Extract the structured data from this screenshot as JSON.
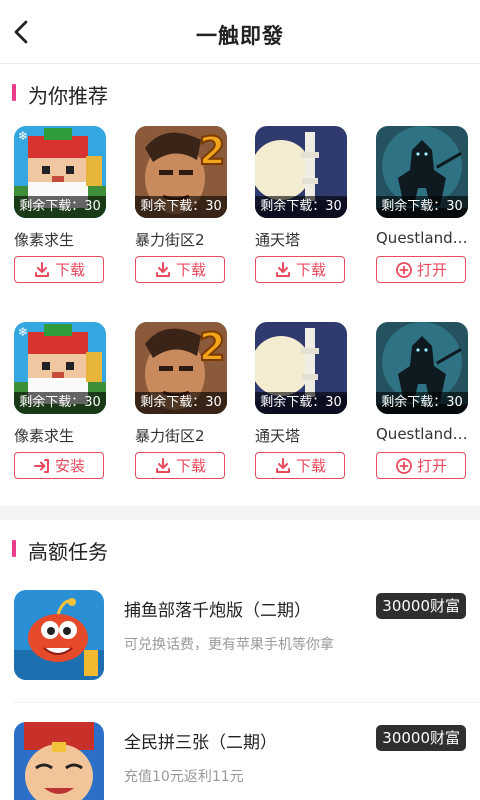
{
  "header": {
    "title": "一触即發"
  },
  "recommend": {
    "title": "为你推荐",
    "rows": [
      [
        {
          "name": "像素求生",
          "tag": "剩余下载：30",
          "button": "下载",
          "button_icon": "download-icon",
          "art": "pixel"
        },
        {
          "name": "暴力街区2",
          "tag": "剩余下载：30",
          "button": "下载",
          "button_icon": "download-icon",
          "art": "fighter"
        },
        {
          "name": "通天塔",
          "tag": "剩余下载：30",
          "button": "下载",
          "button_icon": "download-icon",
          "art": "tower"
        },
        {
          "name": "Questland…",
          "tag": "剩余下载：30",
          "button": "打开",
          "button_icon": "open-icon",
          "art": "knight"
        }
      ],
      [
        {
          "name": "像素求生",
          "tag": "剩余下载：30",
          "button": "安装",
          "button_icon": "install-icon",
          "art": "pixel"
        },
        {
          "name": "暴力街区2",
          "tag": "剩余下载：30",
          "button": "下载",
          "button_icon": "download-icon",
          "art": "fighter"
        },
        {
          "name": "通天塔",
          "tag": "剩余下载：30",
          "button": "下载",
          "button_icon": "download-icon",
          "art": "tower"
        },
        {
          "name": "Questland…",
          "tag": "剩余下载：30",
          "button": "打开",
          "button_icon": "open-icon",
          "art": "knight"
        }
      ]
    ]
  },
  "tasks": {
    "title": "高额任务",
    "items": [
      {
        "name": "捕鱼部落千炮版（二期）",
        "desc": "可兑换话费，更有苹果手机等你拿",
        "reward": "30000财富",
        "art": "fish"
      },
      {
        "name": "全民拼三张（二期）",
        "desc": "充值10元返利11元",
        "reward": "30000财富",
        "art": "cards"
      }
    ]
  },
  "colors": {
    "accent": "#e94a5e",
    "section_bar": "#e83e8c",
    "reward_bg": "#2f2f2f"
  }
}
